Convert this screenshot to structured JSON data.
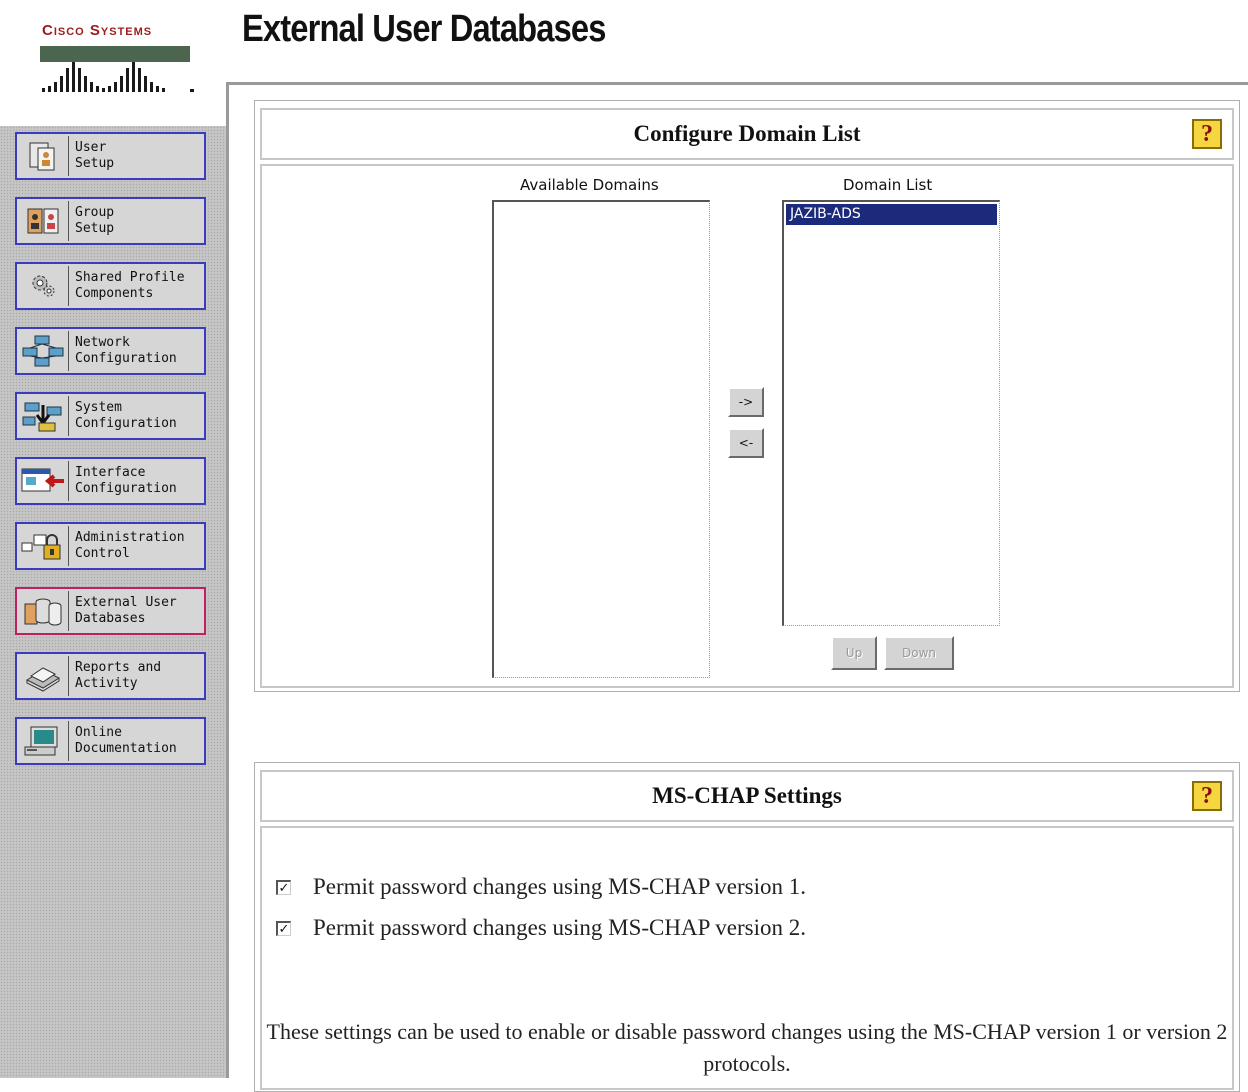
{
  "brand": {
    "logo_text": "Cisco Systems"
  },
  "page": {
    "title": "External User Databases"
  },
  "sidebar": {
    "items": [
      {
        "label": "User\nSetup",
        "icon": "user-setup-icon",
        "active": false
      },
      {
        "label": "Group\nSetup",
        "icon": "group-setup-icon",
        "active": false
      },
      {
        "label": "Shared Profile\nComponents",
        "icon": "shared-profile-icon",
        "active": false
      },
      {
        "label": "Network\nConfiguration",
        "icon": "network-configuration-icon",
        "active": false
      },
      {
        "label": "System\nConfiguration",
        "icon": "system-configuration-icon",
        "active": false
      },
      {
        "label": "Interface\nConfiguration",
        "icon": "interface-configuration-icon",
        "active": false
      },
      {
        "label": "Administration\nControl",
        "icon": "administration-control-icon",
        "active": false
      },
      {
        "label": "External User\nDatabases",
        "icon": "external-user-databases-icon",
        "active": true
      },
      {
        "label": "Reports and\nActivity",
        "icon": "reports-activity-icon",
        "active": false
      },
      {
        "label": "Online\nDocumentation",
        "icon": "online-documentation-icon",
        "active": false
      }
    ]
  },
  "domain_list_section": {
    "title": "Configure Domain List",
    "help_label": "?",
    "available_label": "Available Domains",
    "available_items": [],
    "domain_list_label": "Domain List",
    "domain_list_items": [
      "JAZIB-ADS"
    ],
    "add_button": "->",
    "remove_button": "<-",
    "up_button": "Up",
    "down_button": "Down"
  },
  "mschap_section": {
    "title": "MS-CHAP Settings",
    "help_label": "?",
    "options": [
      {
        "label": "Permit password changes using MS-CHAP version 1.",
        "checked": true
      },
      {
        "label": "Permit password changes using MS-CHAP version 2.",
        "checked": true
      }
    ],
    "note": "These settings can be used to enable or disable password changes using the MS-CHAP version 1 or version 2 protocols."
  },
  "colors": {
    "sidebar_bg": "#c6c6c6",
    "nav_border": "#3b3bc0",
    "nav_active_border": "#c02060",
    "selection": "#1c2a7c",
    "help_icon": "#f3d640",
    "brand": "#9c1c1c"
  }
}
